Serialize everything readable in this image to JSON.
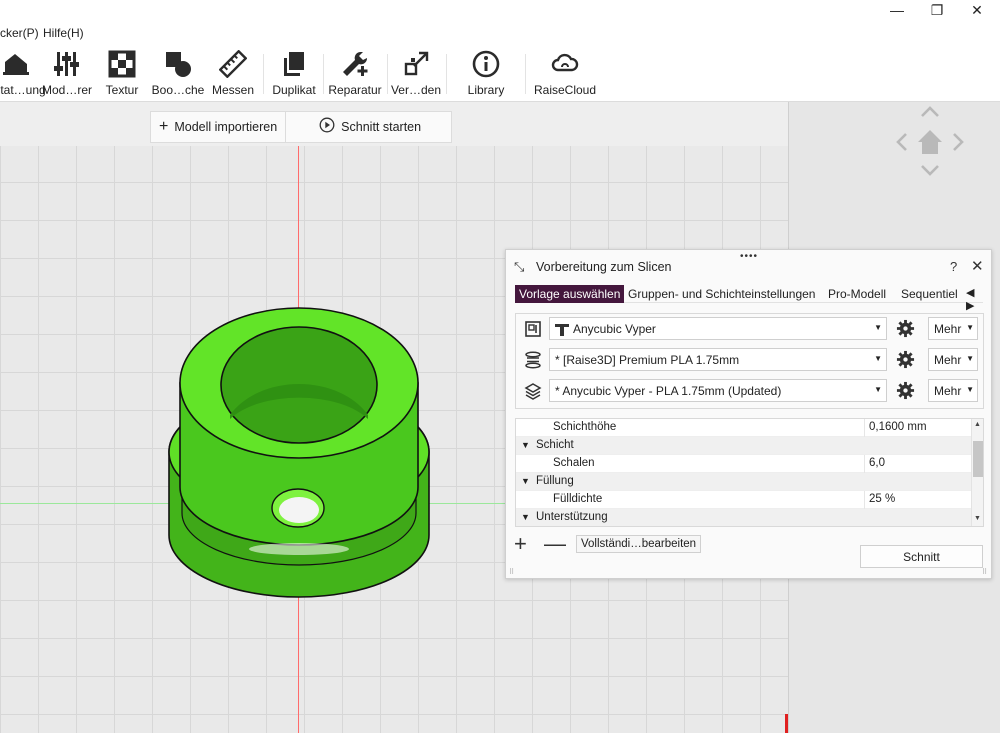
{
  "menu": {
    "items": [
      "cker(P)",
      "Hilfe(H)"
    ]
  },
  "window": {
    "minimize": "—",
    "restore": "❐",
    "close": "✕"
  },
  "toolbar": {
    "items": [
      {
        "label": "…tat…ung",
        "icon": "edit-object-icon"
      },
      {
        "label": "Mod…rer",
        "icon": "modifier-sliders-icon"
      },
      {
        "label": "Textur",
        "icon": "texture-checker-icon"
      },
      {
        "label": "Boo…che",
        "icon": "boolean-shapes-icon"
      },
      {
        "label": "Messen",
        "icon": "ruler-icon"
      },
      {
        "label": "Duplikat",
        "icon": "duplicate-icon"
      },
      {
        "label": "Reparatur",
        "icon": "wrench-plus-icon"
      },
      {
        "label": "Ver…den",
        "icon": "arrange-icon"
      },
      {
        "label": "Library",
        "icon": "info-circle-icon"
      },
      {
        "label": "RaiseCloud",
        "icon": "cloud-icon"
      }
    ]
  },
  "viewport": {
    "import_label": "Modell importieren",
    "slice_label": "Schnitt starten"
  },
  "colors": {
    "accent": "#44173d",
    "model_green": "#5fe026",
    "model_dark_green": "#43b41a",
    "axis_red": "#ff6b6b",
    "axis_green": "#9be89b"
  },
  "dialog": {
    "grip": "••••",
    "title": "Vorbereitung zum Slicen",
    "help": "?",
    "close": "✕",
    "tabs": [
      {
        "label": "Vorlage auswählen",
        "active": true
      },
      {
        "label": "Gruppen- und Schichteinstellungen",
        "active": false
      },
      {
        "label": "Pro-Modell",
        "active": false
      },
      {
        "label": "Sequentiel",
        "active": false
      }
    ],
    "presets": [
      {
        "icon": "printer-icon",
        "value": "Anycubic Vyper",
        "more": "Mehr"
      },
      {
        "icon": "filament-spool-icon",
        "value": "* [Raise3D] Premium PLA 1.75mm",
        "more": "Mehr"
      },
      {
        "icon": "layers-icon",
        "value": "* Anycubic Vyper - PLA 1.75mm (Updated)",
        "more": "Mehr"
      }
    ],
    "settings": [
      {
        "type": "item",
        "key": "Schichthöhe",
        "value": "0,1600 mm"
      },
      {
        "type": "group",
        "key": "Schicht"
      },
      {
        "type": "item",
        "key": "Schalen",
        "value": "6,0"
      },
      {
        "type": "group",
        "key": "Füllung"
      },
      {
        "type": "item",
        "key": "Fülldichte",
        "value": "25 %"
      },
      {
        "type": "group",
        "key": "Unterstützung"
      }
    ],
    "edit_label": "Vollständi…bearbeiten",
    "slice_button": "Schnitt"
  }
}
